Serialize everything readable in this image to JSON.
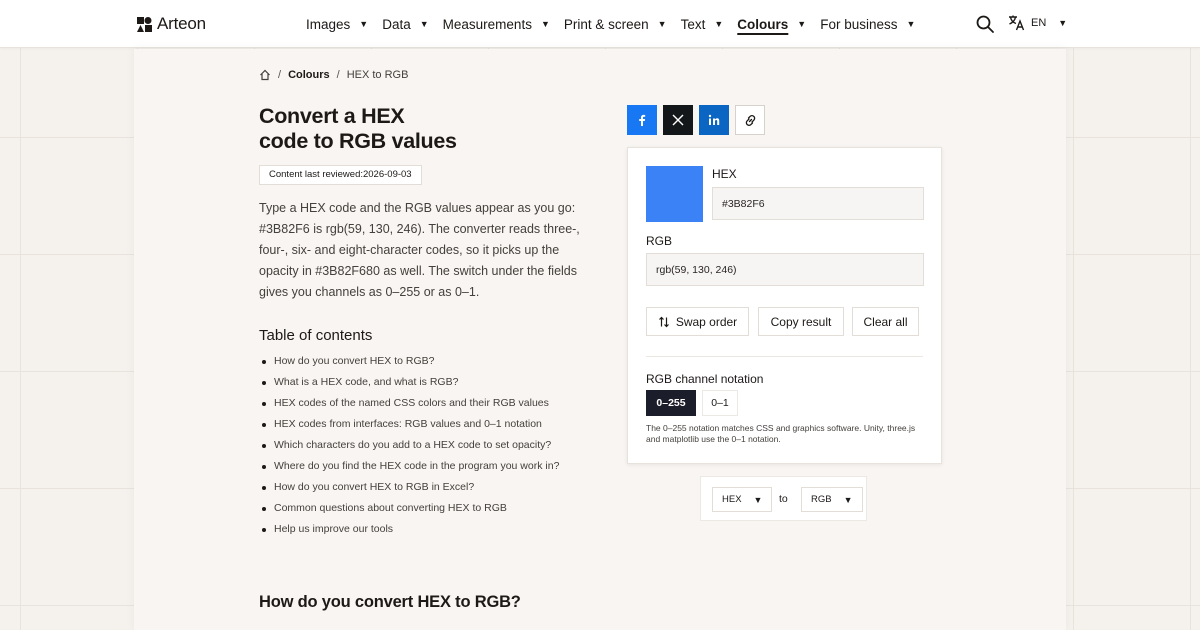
{
  "header": {
    "logo_text": "Arteon",
    "nav": [
      {
        "label": "Images"
      },
      {
        "label": "Data"
      },
      {
        "label": "Measurements"
      },
      {
        "label": "Print & screen"
      },
      {
        "label": "Text"
      },
      {
        "label": "Colours",
        "active": true
      },
      {
        "label": "For business"
      }
    ],
    "lang": "EN"
  },
  "breadcrumb": {
    "parent": "Colours",
    "current": "HEX to RGB",
    "separator": "/"
  },
  "title_line1": "Convert a HEX",
  "title_line2": "code to RGB values",
  "reviewed": "Content last reviewed:2026-09-03",
  "intro": "Type a HEX code and the RGB values appear as you go: #3B82F6 is rgb(59, 130, 246). The converter reads three-, four-, six- and eight-character codes, so it picks up the opacity in #3B82F680 as well. The switch under the fields gives you channels as 0–255 or as 0–1.",
  "toc": {
    "title": "Table of contents",
    "items": [
      "How do you convert HEX to RGB?",
      "What is a HEX code, and what is RGB?",
      "HEX codes of the named CSS colors and their RGB values",
      "HEX codes from interfaces: RGB values and 0–1 notation",
      "Which characters do you add to a HEX code to set opacity?",
      "Where do you find the HEX code in the program you work in?",
      "How do you convert HEX to RGB in Excel?",
      "Common questions about converting HEX to RGB",
      "Help us improve our tools"
    ]
  },
  "section_heading": "How do you convert HEX to RGB?",
  "converter": {
    "swatch_color": "#3B82F6",
    "hex_label": "HEX",
    "hex_value": "#3B82F6",
    "rgb_label": "RGB",
    "rgb_value": "rgb(59, 130, 246)",
    "swap_label": "Swap order",
    "copy_label": "Copy result",
    "clear_label": "Clear all",
    "notation_label": "RGB channel notation",
    "notation_options": [
      "0–255",
      "0–1"
    ],
    "notation_selected": "0–255",
    "note": "The 0–255 notation matches CSS and graphics software. Unity, three.js and matplotlib use the 0–1 notation."
  },
  "unit_select": {
    "from": "HEX",
    "to_word": "to",
    "to": "RGB"
  },
  "colors": {
    "facebook": "#1877F2",
    "x": "#14171A",
    "linkedin": "#0A66C2",
    "notation_active": "#1C1D2B"
  }
}
